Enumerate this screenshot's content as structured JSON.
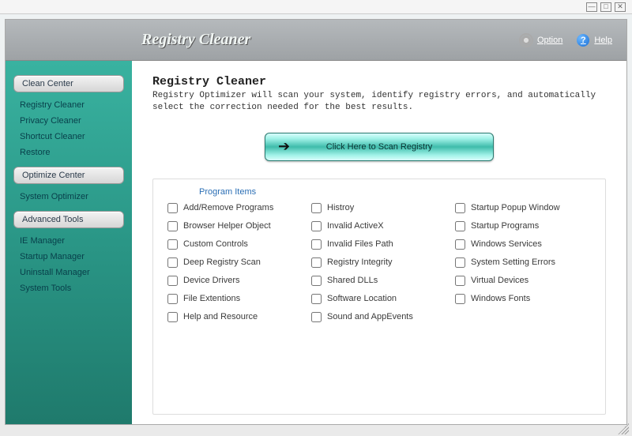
{
  "header": {
    "title": "Registry Cleaner",
    "option_label": "Option",
    "help_label": "Help"
  },
  "sidebar": {
    "groups": [
      {
        "label": "Clean Center",
        "items": [
          "Registry Cleaner",
          "Privacy Cleaner",
          "Shortcut Cleaner",
          "Restore"
        ]
      },
      {
        "label": "Optimize Center",
        "items": [
          "System Optimizer"
        ]
      },
      {
        "label": "Advanced Tools",
        "items": [
          "IE Manager",
          "Startup Manager",
          "Uninstall Manager",
          "System Tools"
        ]
      }
    ]
  },
  "main": {
    "title": "Registry Cleaner",
    "description": "Registry Optimizer will scan your system, identify registry errors, and automatically select the correction needed for the best results.",
    "scan_button": "Click Here to Scan Registry",
    "items_title": "Program Items",
    "items_col1": [
      "Add/Remove Programs",
      "Browser Helper Object",
      "Custom Controls",
      "Deep Registry Scan",
      "Device Drivers",
      "File Extentions",
      "Help and Resource"
    ],
    "items_col2": [
      "Histroy",
      "Invalid ActiveX",
      "Invalid Files Path",
      "Registry Integrity",
      "Shared DLLs",
      "Software Location",
      "Sound and AppEvents"
    ],
    "items_col3": [
      "Startup Popup Window",
      "Startup Programs",
      "Windows Services",
      "System Setting Errors",
      "Virtual Devices",
      "Windows Fonts"
    ]
  }
}
